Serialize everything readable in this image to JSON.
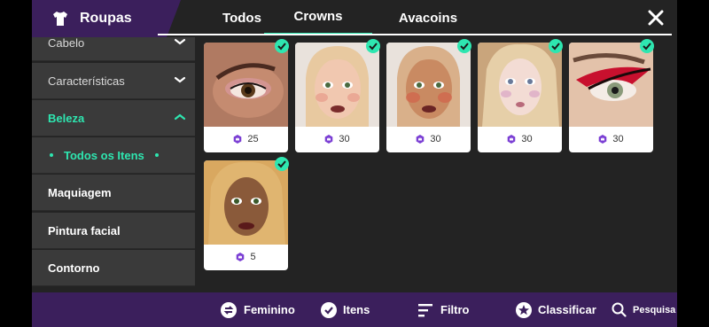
{
  "header": {
    "category_label": "Roupas",
    "tabs": [
      {
        "label": "Todos"
      },
      {
        "label": "Crowns"
      },
      {
        "label": "Avacoins"
      }
    ]
  },
  "sidebar": {
    "items": [
      {
        "label": "Cabelo"
      },
      {
        "label": "Características"
      },
      {
        "label": "Beleza"
      },
      {
        "label": "Todos os Itens"
      },
      {
        "label": "Maquiagem"
      },
      {
        "label": "Pintura facial"
      },
      {
        "label": "Contorno"
      }
    ]
  },
  "items": [
    {
      "price": "25",
      "owned": true
    },
    {
      "price": "30",
      "owned": true
    },
    {
      "price": "30",
      "owned": true
    },
    {
      "price": "30",
      "owned": true
    },
    {
      "price": "30",
      "owned": true
    },
    {
      "price": "5",
      "owned": true
    }
  ],
  "bottom_bar": {
    "gender_label": "Feminino",
    "items_label": "Itens",
    "filter_label": "Filtro",
    "sort_label": "Classificar",
    "search_label": "Pesquisa"
  },
  "colors": {
    "accent": "#2ee6b0",
    "header_purple": "#3b1f5c",
    "crown": "#7b3fd4"
  }
}
